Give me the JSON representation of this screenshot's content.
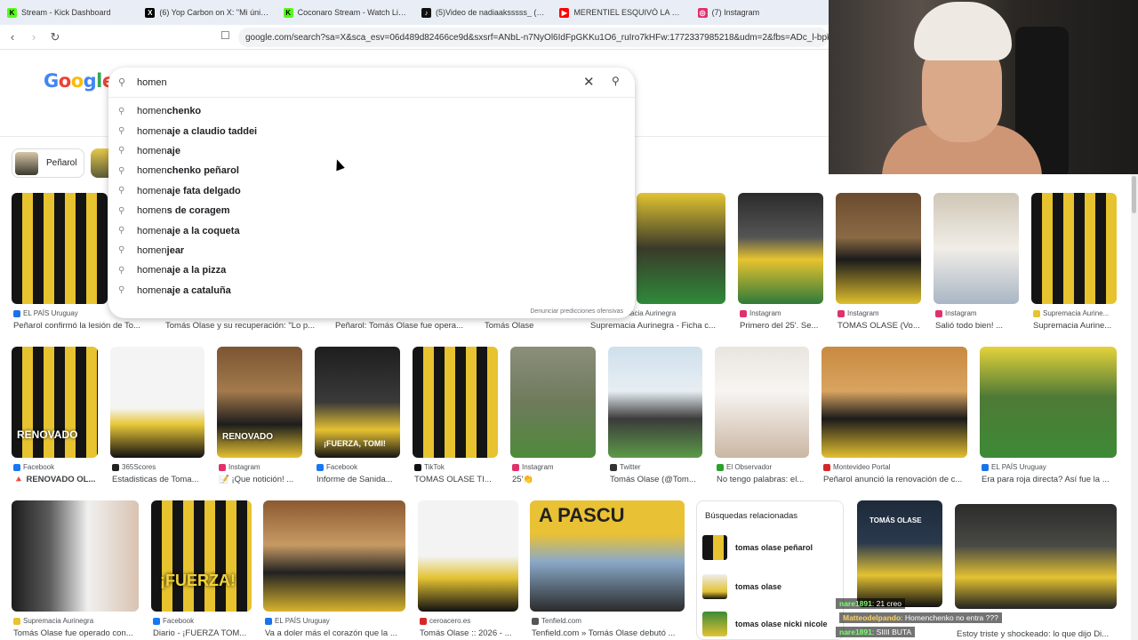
{
  "tabs": [
    {
      "label": "Stream - Kick Dashboard",
      "color": "#53fc18",
      "glyph": "K"
    },
    {
      "label": "(6) Yop Carbon on X: \"Mi único héro",
      "color": "#000000",
      "glyph": "X"
    },
    {
      "label": "Coconaro Stream - Watch Live on Ki",
      "color": "#53fc18",
      "glyph": "K"
    },
    {
      "label": "(5)Video de nadiaaksssss_ (@nadia",
      "color": "#111111",
      "glyph": "♪"
    },
    {
      "label": "MERENTIEL ESQUIVÓ LA DERROTA Y",
      "color": "#ff0000",
      "glyph": "▶"
    },
    {
      "label": "(7) Instagram",
      "color": "#e1306c",
      "glyph": "◎"
    }
  ],
  "address_bar": {
    "url": "google.com/search?sa=X&sca_esv=06d489d82466ce9d&sxsrf=ANbL-n7NyOl6IdFpGKKu1O6_ruIro7kHFw:1772337985218&udm=2&fbs=ADc_l-bpk8..."
  },
  "google_logo": [
    "G",
    "o",
    "o",
    "g",
    "l",
    "e"
  ],
  "search": {
    "query": "homen",
    "report_text": "Denunciar predicciones ofensivas",
    "suggestions": [
      {
        "typed": "homen",
        "rest": "chenko"
      },
      {
        "typed": "homen",
        "rest": "aje a claudio taddei"
      },
      {
        "typed": "homen",
        "rest": "aje"
      },
      {
        "typed": "homen",
        "rest": "chenko peñarol"
      },
      {
        "typed": "homen",
        "rest": "aje fata delgado"
      },
      {
        "typed": "homen",
        "rest": "s de coragem"
      },
      {
        "typed": "homen",
        "rest": "aje a la coqueta"
      },
      {
        "typed": "homen",
        "rest": "jear"
      },
      {
        "typed": "homen",
        "rest": "aje a la pizza"
      },
      {
        "typed": "homen",
        "rest": "aje a cataluña"
      }
    ]
  },
  "chip": {
    "label": "Peñarol"
  },
  "row1": [
    {
      "source": "EL PAÍS Uruguay",
      "title": "Peñarol confirmó la lesión de To...",
      "fav": "#1a73e8"
    },
    {
      "source": "",
      "title": "Tomás Olase y su recuperación: \"Lo p...",
      "fav": "#888888"
    },
    {
      "source": "",
      "title": "Peñarol: Tomás Olase fue opera...",
      "fav": "#888888"
    },
    {
      "source": "",
      "title": "Tomás Olase",
      "fav": "#888888"
    },
    {
      "source": "Supremacia Aurinegra",
      "title": "Supremacia Aurinegra - Ficha c...",
      "fav": "#e7c32f"
    },
    {
      "source": "Instagram",
      "title": "Primero del 25'. Se...",
      "fav": "#e1306c"
    },
    {
      "source": "Instagram",
      "title": "TOMAS OLASE (Vo...",
      "fav": "#e1306c"
    },
    {
      "source": "Instagram",
      "title": "Salió todo bien! ...",
      "fav": "#e1306c"
    },
    {
      "source": "Supremacia Aurine...",
      "title": "Supremacia Aurine...",
      "fav": "#e7c32f"
    }
  ],
  "row2": [
    {
      "source": "Facebook",
      "title": "🔺 RENOVADO OL...",
      "fav": "#1877f2",
      "caption": "RENOVADO"
    },
    {
      "source": "365Scores",
      "title": "Estadisticas de Toma...",
      "fav": "#222222",
      "caption": ""
    },
    {
      "source": "Instagram",
      "title": "📝 ¡Que notición! ...",
      "fav": "#e1306c",
      "caption": "RENOVADO"
    },
    {
      "source": "Facebook",
      "title": "Informe de Sanida...",
      "fav": "#1877f2",
      "caption": "¡FUERZA, TOMI!"
    },
    {
      "source": "TikTok",
      "title": "TOMAS OLASE TI...",
      "fav": "#111111",
      "caption": ""
    },
    {
      "source": "Instagram",
      "title": "25'👏",
      "fav": "#e1306c",
      "caption": ""
    },
    {
      "source": "Twitter",
      "title": "Tomás Olase (@Tom...",
      "fav": "#333333",
      "caption": ""
    },
    {
      "source": "El Observador",
      "title": "No tengo palabras: el...",
      "fav": "#2ca02c",
      "caption": ""
    },
    {
      "source": "Montevideo Portal",
      "title": "Peñarol anunció la renovación de c...",
      "fav": "#d62728",
      "caption": ""
    },
    {
      "source": "EL PAÍS Uruguay",
      "title": "Era para roja directa? Así fue la ...",
      "fav": "#1a73e8",
      "caption": ""
    }
  ],
  "row3": [
    {
      "source": "Supremacia Aurinegra",
      "title": "Tomás Olase fue operado con...",
      "fav": "#e7c32f",
      "caption": ""
    },
    {
      "source": "Facebook",
      "title": "Diario - ¡FUERZA TOM...",
      "fav": "#1877f2",
      "caption": "¡FUERZA!"
    },
    {
      "source": "EL PAÍS Uruguay",
      "title": "Va a doler más el corazón que la ...",
      "fav": "#1a73e8",
      "caption": ""
    },
    {
      "source": "ceroacero.es",
      "title": "Tomás Olase :: 2026 - ...",
      "fav": "#d62728",
      "caption": ""
    },
    {
      "source": "Tenfield.com",
      "title": "Tenfield.com » Tomás Olase debutó ...",
      "fav": "#555555",
      "caption": "A PASCU"
    }
  ],
  "related": {
    "heading": "Búsquedas relacionadas",
    "items": [
      {
        "label": "tomas olase peñarol"
      },
      {
        "label": "tomas olase"
      },
      {
        "label": "tomas olase nicki nicole"
      }
    ]
  },
  "row3_right": [
    {
      "source": "",
      "title": "",
      "caption": "TOMÁS OLASE"
    },
    {
      "source": "",
      "title": "Estoy triste y shockeado: lo que dijo Di...",
      "caption": ""
    }
  ],
  "chat": [
    {
      "user": "nare1891",
      "msg": ": 21 creo"
    },
    {
      "user": "Matteodelpando",
      "msg": ": Homenchenko no entra ???"
    },
    {
      "user": "nare1891",
      "msg": ": SIIII"
    },
    {
      "user": "",
      "msg": "BUTA"
    }
  ]
}
